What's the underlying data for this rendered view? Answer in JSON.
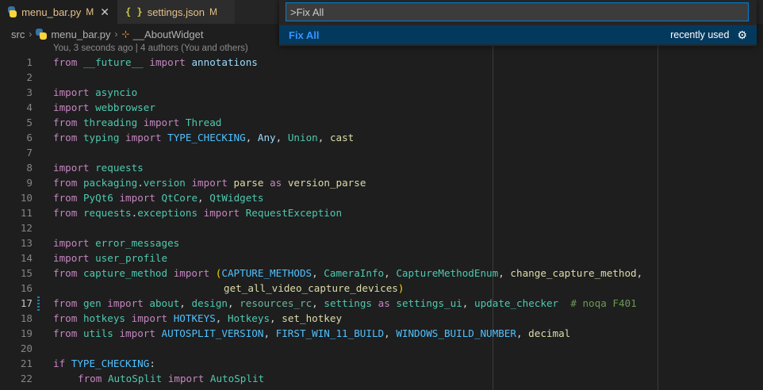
{
  "tabs": [
    {
      "label": "menu_bar.py",
      "modified": "M",
      "close": "✕",
      "icon": "python-icon"
    },
    {
      "label": "settings.json",
      "modified": "M",
      "icon": "json-icon",
      "icon_glyph": "{ }"
    }
  ],
  "breadcrumb": {
    "items": [
      "src",
      "menu_bar.py",
      "__AboutWidget"
    ],
    "separator": "›"
  },
  "blame": "You, 3 seconds ago | 4 authors (You and others)",
  "palette": {
    "input_value": ">Fix All",
    "result_label": "Fix All",
    "result_hint": "recently used"
  },
  "editor": {
    "current_line": 17,
    "lines": [
      {
        "n": "1"
      },
      {
        "n": "2"
      },
      {
        "n": "3"
      },
      {
        "n": "4"
      },
      {
        "n": "5"
      },
      {
        "n": "6"
      },
      {
        "n": "7"
      },
      {
        "n": "8"
      },
      {
        "n": "9"
      },
      {
        "n": "10"
      },
      {
        "n": "11"
      },
      {
        "n": "12"
      },
      {
        "n": "13"
      },
      {
        "n": "14"
      },
      {
        "n": "15"
      },
      {
        "n": "16"
      },
      {
        "n": "17"
      },
      {
        "n": "18"
      },
      {
        "n": "19"
      },
      {
        "n": "20"
      },
      {
        "n": "21"
      },
      {
        "n": "22"
      }
    ],
    "code": {
      "l1": [
        "from",
        "__future__",
        "import",
        "annotations"
      ],
      "l3": [
        "import",
        "asyncio"
      ],
      "l4": [
        "import",
        "webbrowser"
      ],
      "l5": [
        "from",
        "threading",
        "import",
        "Thread"
      ],
      "l6": [
        "from",
        "typing",
        "import",
        "TYPE_CHECKING",
        ",",
        "Any",
        ",",
        "Union",
        ",",
        "cast"
      ],
      "l8": [
        "import",
        "requests"
      ],
      "l9": [
        "from",
        "packaging",
        ".",
        "version",
        "import",
        "parse",
        "as",
        "version_parse"
      ],
      "l10": [
        "from",
        "PyQt6",
        "import",
        "QtCore",
        ",",
        "QtWidgets"
      ],
      "l11": [
        "from",
        "requests",
        ".",
        "exceptions",
        "import",
        "RequestException"
      ],
      "l13": [
        "import",
        "error_messages"
      ],
      "l14": [
        "import",
        "user_profile"
      ],
      "l15": [
        "from",
        "capture_method",
        "import",
        "(",
        "CAPTURE_METHODS",
        ",",
        "CameraInfo",
        ",",
        "CaptureMethodEnum",
        ",",
        "change_capture_method",
        ","
      ],
      "l16": [
        "get_all_video_capture_devices",
        ")"
      ],
      "l17": [
        "from",
        "gen",
        "import",
        "about",
        ",",
        "design",
        ",",
        "resources_rc",
        ",",
        "settings",
        "as",
        "settings_ui",
        ",",
        "update_checker",
        "# noqa F401"
      ],
      "l18": [
        "from",
        "hotkeys",
        "import",
        "HOTKEYS",
        ",",
        "Hotkeys",
        ",",
        "set_hotkey"
      ],
      "l19": [
        "from",
        "utils",
        "import",
        "AUTOSPLIT_VERSION",
        ",",
        "FIRST_WIN_11_BUILD",
        ",",
        "WINDOWS_BUILD_NUMBER",
        ",",
        "decimal"
      ],
      "l21": [
        "if",
        "TYPE_CHECKING",
        ":"
      ],
      "l22": [
        "from",
        "AutoSplit",
        "import",
        "AutoSplit"
      ]
    }
  },
  "colors": {
    "keyword": "#c586c0",
    "builtin": "#569cd6",
    "module": "#4ec9b0",
    "variable": "#9cdcfe",
    "constant": "#4fc1ff",
    "function": "#dcdcaa",
    "comment": "#6a9955",
    "accent": "#007fd4"
  }
}
